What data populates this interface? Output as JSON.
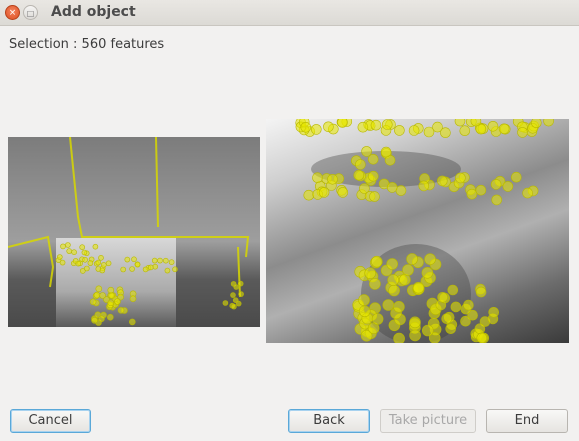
{
  "window": {
    "title": "Add object",
    "close_icon": "×",
    "maximize_icon": "□"
  },
  "status": {
    "selection_text": "Selection : 560 features"
  },
  "images": {
    "left_icon": "camera-frame-with-features",
    "right_icon": "object-image-with-features",
    "feature_color": "#ffff00"
  },
  "buttons": {
    "cancel": "Cancel",
    "back": "Back",
    "take_picture": "Take picture",
    "end": "End"
  }
}
